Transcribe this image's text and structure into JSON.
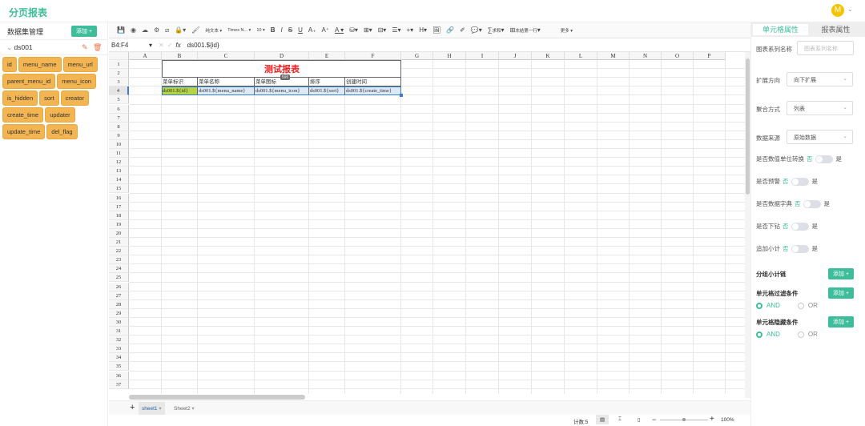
{
  "app": {
    "title": "分页报表",
    "avatar": "M"
  },
  "sidebar": {
    "title": "数据集管理",
    "add": "添加 +",
    "dataset": "ds001",
    "fields": [
      [
        "id",
        "menu_name",
        "menu_url"
      ],
      [
        "parent_menu_id",
        "menu_icon"
      ],
      [
        "is_hidden",
        "sort",
        "creator"
      ],
      [
        "create_time",
        "updater"
      ],
      [
        "update_time",
        "del_flag"
      ]
    ]
  },
  "toolbar": {
    "text_type": "纯文本",
    "font": "Times N...",
    "size": "10",
    "bold": "B",
    "italic": "I",
    "strike": "S",
    "underline": "U",
    "sum": "求和",
    "freeze": "冻结第一行",
    "more": "更多"
  },
  "formula": {
    "cell_ref": "B4:F4",
    "fx": "fx",
    "value": "ds001.${id}"
  },
  "grid": {
    "columns": [
      "A",
      "B",
      "C",
      "D",
      "E",
      "F",
      "G",
      "H",
      "I",
      "J",
      "K",
      "L",
      "M",
      "N",
      "O",
      "P"
    ],
    "row_count": 37,
    "title": "测试报表",
    "headers": [
      "菜单标识",
      "菜单名称",
      "菜单图标",
      "排序",
      "创建时间"
    ],
    "values": [
      "ds001.${id}",
      "ds001.${menu_name}",
      "ds001.${menu_icon}",
      "ds001.${sort}",
      "ds001.${create_time}"
    ],
    "badge": "5列"
  },
  "sheets": {
    "add": "+",
    "tabs": [
      "sheet1",
      "Sheet2"
    ]
  },
  "status": {
    "count": "计数:5",
    "zoom": "100%"
  },
  "panel": {
    "tabs": [
      "单元格属性",
      "报表属性"
    ],
    "series_label": "图表系列名称",
    "series_placeholder": "图表系列名称",
    "selects": [
      {
        "label": "扩展方向",
        "value": "向下扩展"
      },
      {
        "label": "聚合方式",
        "value": "列表"
      },
      {
        "label": "数据来源",
        "value": "原始数据"
      }
    ],
    "toggles": [
      {
        "label": "是否数值单位转换",
        "off": "否",
        "on": "是"
      },
      {
        "label": "是否预警",
        "off": "否",
        "on": "是"
      },
      {
        "label": "是否数据字典",
        "off": "否",
        "on": "是"
      },
      {
        "label": "是否下钻",
        "off": "否",
        "on": "是"
      },
      {
        "label": "追加小计",
        "off": "否",
        "on": "是"
      }
    ],
    "sections": [
      {
        "label": "分组小计链",
        "add": "添加 +"
      },
      {
        "label": "单元格过滤条件",
        "add": "添加 +"
      },
      {
        "label": "单元格隐藏条件",
        "add": "添加 +"
      }
    ],
    "and": "AND",
    "or": "OR"
  }
}
